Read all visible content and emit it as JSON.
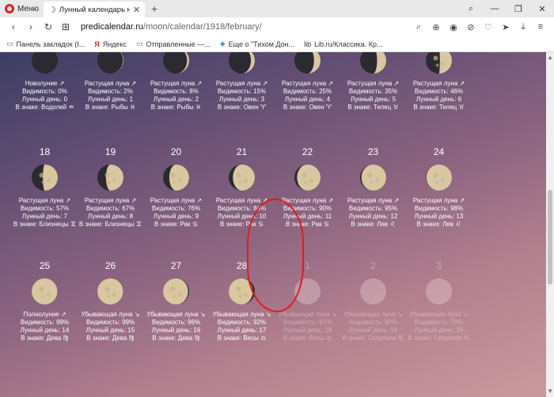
{
  "browser": {
    "menu_label": "Меню",
    "tab_title": "Лунный календарь на Фе",
    "new_tab": "+",
    "url_host": "predicalendar.ru",
    "url_path": "/moon/calendar/1918/february/",
    "bookmarks": [
      {
        "label": "Панель закладок (I...",
        "icon": "folder-icon"
      },
      {
        "label": "Яндекс",
        "icon": "yandex-icon"
      },
      {
        "label": "Отправленные —...",
        "icon": "folder-icon"
      },
      {
        "label": "Еще о \"Тихом Дон...",
        "icon": "shield-icon"
      },
      {
        "label": "Lib.ru/Классика. Кр...",
        "icon": "lib-icon"
      }
    ]
  },
  "calendar": {
    "row1": [
      {
        "phase": "Новолуние ↗",
        "visibility": "Видимость: 0%",
        "lunar_day": "Лунный день: 0",
        "sign": "В знаке: Водолей ♒"
      },
      {
        "phase": "Растущая луна ↗",
        "visibility": "Видимость: 2%",
        "lunar_day": "Лунный день: 1",
        "sign": "В знаке: Рыбы ♓"
      },
      {
        "phase": "Растущая луна ↗",
        "visibility": "Видимость: 8%",
        "lunar_day": "Лунный день: 2",
        "sign": "В знаке: Рыбы ♓"
      },
      {
        "phase": "Растущая луна ↗",
        "visibility": "Видимость: 15%",
        "lunar_day": "Лунный день: 3",
        "sign": "В знаке: Овен ♈"
      },
      {
        "phase": "Растущая луна ↗",
        "visibility": "Видимость: 25%",
        "lunar_day": "Лунный день: 4",
        "sign": "В знаке: Овен ♈"
      },
      {
        "phase": "Растущая луна ↗",
        "visibility": "Видимость: 35%",
        "lunar_day": "Лунный день: 5",
        "sign": "В знаке: Телец ♉"
      },
      {
        "phase": "Растущая луна ↗",
        "visibility": "Видимость: 46%",
        "lunar_day": "Лунный день: 6",
        "sign": "В знаке: Телец ♉"
      }
    ],
    "row2": [
      {
        "day": "18",
        "phase": "Растущая луна ↗",
        "visibility": "Видимость: 57%",
        "lunar_day": "Лунный день: 7",
        "sign": "В знаке: Близнецы ♊"
      },
      {
        "day": "19",
        "phase": "Растущая луна ↗",
        "visibility": "Видимость: 67%",
        "lunar_day": "Лунный день: 8",
        "sign": "В знаке: Близнецы ♊"
      },
      {
        "day": "20",
        "phase": "Растущая луна ↗",
        "visibility": "Видимость: 76%",
        "lunar_day": "Лунный день: 9",
        "sign": "В знаке: Рак ♋"
      },
      {
        "day": "21",
        "phase": "Растущая луна ↗",
        "visibility": "Видимость: 84%",
        "lunar_day": "Лунный день: 10",
        "sign": "В знаке: Рак ♋"
      },
      {
        "day": "22",
        "phase": "Растущая луна ↗",
        "visibility": "Видимость: 90%",
        "lunar_day": "Лунный день: 11",
        "sign": "В знаке: Рак ♋"
      },
      {
        "day": "23",
        "phase": "Растущая луна ↗",
        "visibility": "Видимость: 95%",
        "lunar_day": "Лунный день: 12",
        "sign": "В знаке: Лев ♌"
      },
      {
        "day": "24",
        "phase": "Растущая луна ↗",
        "visibility": "Видимость: 98%",
        "lunar_day": "Лунный день: 13",
        "sign": "В знаке: Лев ♌"
      }
    ],
    "row3": [
      {
        "day": "25",
        "phase": "Полнолуние ↗",
        "visibility": "Видимость: 99%",
        "lunar_day": "Лунный день: 14",
        "sign": "В знаке: Дева ♍"
      },
      {
        "day": "26",
        "phase": "Убывающая луна ↘",
        "visibility": "Видимость: 99%",
        "lunar_day": "Лунный день: 15",
        "sign": "В знаке: Дева ♍"
      },
      {
        "day": "27",
        "phase": "Убывающая луна ↘",
        "visibility": "Видимость: 96%",
        "lunar_day": "Лунный день: 16",
        "sign": "В знаке: Дева ♍"
      },
      {
        "day": "28",
        "phase": "Убывающая луна ↘",
        "visibility": "Видимость: 92%",
        "lunar_day": "Лунный день: 17",
        "sign": "В знаке: Весы ♎"
      },
      {
        "day": "1",
        "phase": "Убывающая луна ↘",
        "visibility": "Видимость: 87%",
        "lunar_day": "Лунный день: 18",
        "sign": "В знаке: Весы ♎"
      },
      {
        "day": "2",
        "phase": "Убывающая луна ↘",
        "visibility": "Видимость: 80%",
        "lunar_day": "Лунный день: 19",
        "sign": "В знаке: Скорпион ♏"
      },
      {
        "day": "3",
        "phase": "Убывающая луна ↘",
        "visibility": "Видимость: 72%",
        "lunar_day": "Лунный день: 20",
        "sign": "В знаке: Скорпион ♏"
      }
    ]
  },
  "colors": {
    "moon_lit": "#d9c7a2",
    "moon_dark": "#2a2a30",
    "highlight": "#e21b1b"
  }
}
